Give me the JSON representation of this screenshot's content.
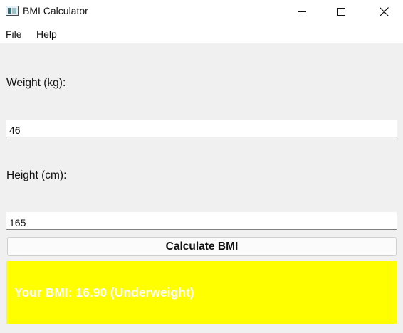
{
  "window": {
    "title": "BMI Calculator",
    "icon": "app-window-icon"
  },
  "menu": {
    "items": [
      {
        "label": "File"
      },
      {
        "label": "Help"
      }
    ]
  },
  "form": {
    "weight_label": "Weight (kg):",
    "weight_value": "46",
    "height_label": "Height (cm):",
    "height_value": "165",
    "calculate_label": "Calculate BMI"
  },
  "result": {
    "text": "Your BMI: 16.90 (Underweight)",
    "background_color": "#ffff00",
    "text_color": "#ffffff"
  }
}
